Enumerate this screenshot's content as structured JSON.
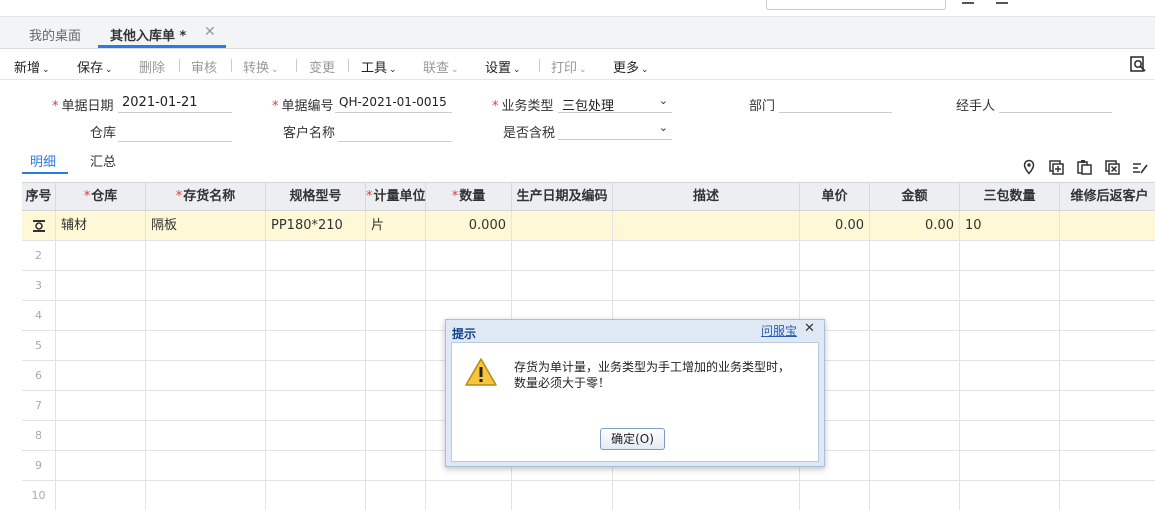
{
  "topbar": {
    "crumb_text": ""
  },
  "tabs": [
    {
      "label": "我的桌面"
    },
    {
      "label": "其他入库单 *"
    }
  ],
  "tab_close_glyph": "✕",
  "toolbar": {
    "items": [
      {
        "label": "新增",
        "caret": "⌄"
      },
      {
        "label": "保存",
        "caret": "⌄"
      },
      {
        "label": "删除"
      },
      {
        "label": "审核"
      },
      {
        "label": "转换",
        "caret": "⌄"
      },
      {
        "label": "变更"
      },
      {
        "label": "工具",
        "caret": "⌄"
      },
      {
        "label": "联查",
        "caret": "⌄"
      },
      {
        "label": "设置",
        "caret": "⌄"
      },
      {
        "label": "打印",
        "caret": "⌄"
      },
      {
        "label": "更多",
        "caret": "⌄"
      }
    ]
  },
  "form": {
    "date_label": "单据日期",
    "date_value": "2021-01-21",
    "code_label": "单据编号",
    "code_value": "QH-2021-01-0015",
    "biz_type_label": "业务类型",
    "biz_type_value": "三包处理",
    "dept_label": "部门",
    "dept_value": "",
    "handler_label": "经手人",
    "handler_value": "",
    "warehouse_label": "仓库",
    "warehouse_value": "",
    "customer_label": "客户名称",
    "customer_value": "",
    "tax_label": "是否含税",
    "tax_value": ""
  },
  "required_mark": "*",
  "dropdown_glyph": "⌄",
  "subtabs": {
    "detail": "明细",
    "summary": "汇总"
  },
  "grid": {
    "headers": [
      "序号",
      "仓库",
      "存货名称",
      "规格型号",
      "计量单位",
      "数量",
      "生产日期及编码",
      "描述",
      "单价",
      "金额",
      "三包数量",
      "维修后返客户"
    ],
    "rows": [
      {
        "index": "",
        "warehouse": "辅材",
        "name": "隔板",
        "spec": "PP180*210",
        "unit": "片",
        "qty": "0.000",
        "prod": "",
        "desc": "",
        "price": "0.00",
        "amount": "0.00",
        "warranty_qty": "10",
        "return": ""
      },
      {
        "index": "2"
      },
      {
        "index": "3"
      },
      {
        "index": "4"
      },
      {
        "index": "5"
      },
      {
        "index": "6"
      },
      {
        "index": "7"
      },
      {
        "index": "8"
      },
      {
        "index": "9"
      },
      {
        "index": "10"
      }
    ]
  },
  "dialog": {
    "title": "提示",
    "help_link": "问服宝",
    "close_glyph": "✕",
    "message_line1": "存货为单计量，业务类型为手工增加的业务类型时，",
    "message_line2": "数量必须大于零！",
    "ok_label": "确定(O)"
  },
  "colors": {
    "accent": "#2a7be4",
    "required": "#e4393c",
    "selected_row": "#fff8d6",
    "dialog_frame": "#dfe8f5"
  }
}
